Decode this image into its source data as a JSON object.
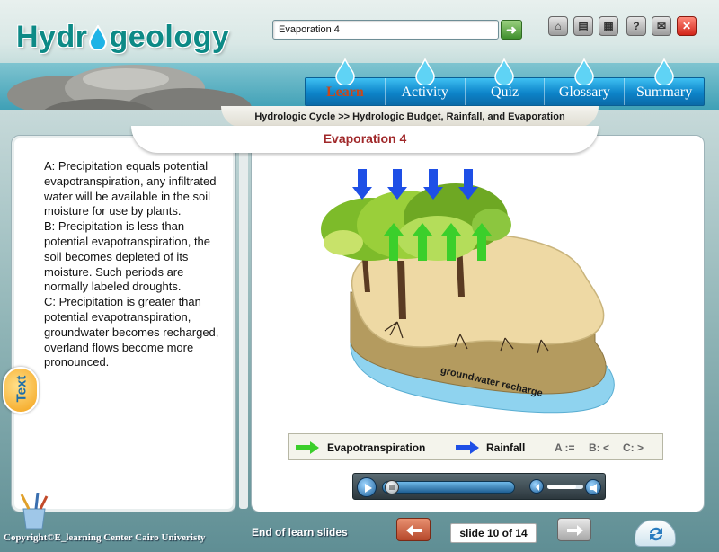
{
  "app": {
    "logo_text_left": "Hydr",
    "logo_text_right": "geology",
    "logo_drop_icon": "water-drop-icon"
  },
  "search": {
    "value": "Evaporation 4",
    "go_icon": "arrow-right-icon"
  },
  "toolbar": {
    "buttons": [
      {
        "name": "home",
        "icon": "home-icon",
        "glyph": "⌂"
      },
      {
        "name": "print",
        "icon": "printer-icon",
        "glyph": "▤"
      },
      {
        "name": "notes",
        "icon": "document-icon",
        "glyph": "▦"
      },
      {
        "name": "help",
        "icon": "help-icon",
        "glyph": "?"
      },
      {
        "name": "mail",
        "icon": "mail-icon",
        "glyph": "✉"
      },
      {
        "name": "close",
        "icon": "close-icon",
        "glyph": "✕"
      }
    ]
  },
  "nav": {
    "tabs": [
      {
        "label": "Learn",
        "active": true
      },
      {
        "label": "Activity",
        "active": false
      },
      {
        "label": "Quiz",
        "active": false
      },
      {
        "label": "Glossary",
        "active": false
      },
      {
        "label": "Summary",
        "active": false
      }
    ]
  },
  "breadcrumb": {
    "text": "Hydrologic Cycle >>  Hydrologic Budget, Rainfall, and Evaporation"
  },
  "page": {
    "title": "Evaporation 4"
  },
  "content": {
    "paragraphs": [
      "A: Precipitation equals potential evapotranspiration, any infiltrated water will be available in the soil moisture for use by plants.",
      "B: Precipitation is less than potential evapotranspiration, the soil becomes depleted of its moisture. Such periods are normally labeled droughts.",
      "C: Precipitation is greater than potential evapotranspiration, groundwater becomes recharged, overland flows become more pronounced."
    ],
    "side_tab_label": "Text"
  },
  "diagram": {
    "label": "groundwater recharge",
    "rainfall_color": "#1e4fe6",
    "evapotranspiration_color": "#3bcf2b"
  },
  "legend": {
    "evapotranspiration": "Evapotranspiration",
    "rainfall": "Rainfall",
    "code_a": "A :=",
    "code_b": "B: <",
    "code_c": "C: >"
  },
  "media": {
    "progress": 0.0,
    "volume": 0.8,
    "play_icon": "play-icon",
    "seek_thumb_icon": "pause-icon",
    "volume_icon": "speaker-icon"
  },
  "footer": {
    "copyright": "Copyright©E_learning Center Cairo Univeristy",
    "status": "End of learn slides",
    "slide_counter": "slide 10 of 14",
    "prev_icon": "back-arrow-icon",
    "next_icon": "forward-arrow-icon",
    "refresh_icon": "refresh-icon"
  }
}
